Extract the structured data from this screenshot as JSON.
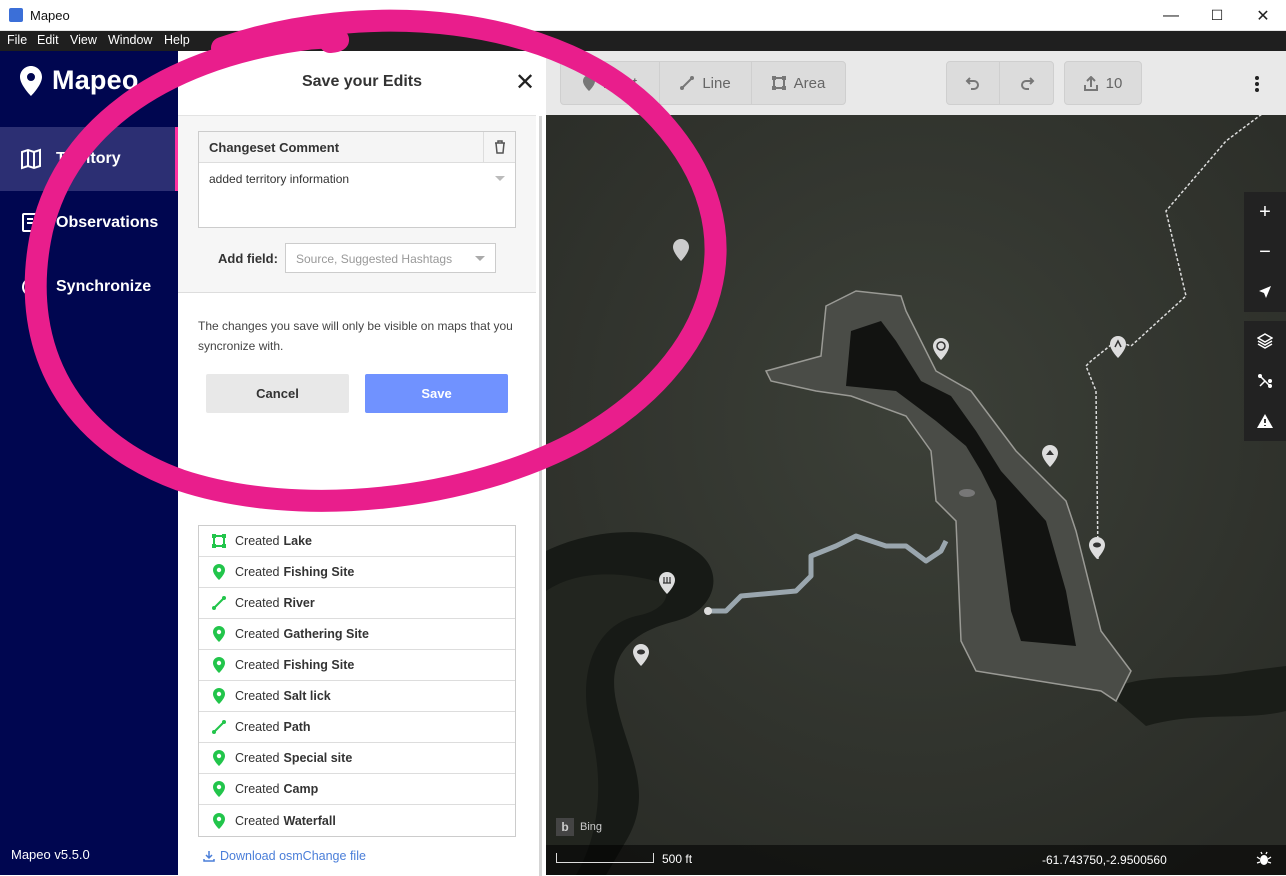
{
  "window": {
    "title": "Mapeo",
    "minimize": "—",
    "maximize": "☐",
    "close": "✕"
  },
  "menu": [
    "File",
    "Edit",
    "View",
    "Window",
    "Help"
  ],
  "sidebar": {
    "logo": "Mapeo",
    "items": [
      {
        "label": "Territory",
        "icon": "map-icon",
        "active": true
      },
      {
        "label": "Observations",
        "icon": "observations-icon"
      },
      {
        "label": "Synchronize",
        "icon": "sync-icon"
      }
    ],
    "version": "Mapeo v5.5.0"
  },
  "panel": {
    "title": "Save your Edits",
    "close": "✕",
    "comment_label": "Changeset Comment",
    "comment_value": "added territory information",
    "add_field_label": "Add field:",
    "add_field_placeholder": "Source, Suggested Hashtags",
    "note": "The changes you save will only be visible on maps that you syncronize with.",
    "cancel": "Cancel",
    "save": "Save",
    "changes": [
      {
        "verb": "Created",
        "name": "Lake",
        "icon": "area-icon"
      },
      {
        "verb": "Created",
        "name": "Fishing Site",
        "icon": "point-icon"
      },
      {
        "verb": "Created",
        "name": "River",
        "icon": "line-icon"
      },
      {
        "verb": "Created",
        "name": "Gathering Site",
        "icon": "point-icon"
      },
      {
        "verb": "Created",
        "name": "Fishing Site",
        "icon": "point-icon"
      },
      {
        "verb": "Created",
        "name": "Salt lick",
        "icon": "point-icon"
      },
      {
        "verb": "Created",
        "name": "Path",
        "icon": "line-icon"
      },
      {
        "verb": "Created",
        "name": "Special site",
        "icon": "point-icon"
      },
      {
        "verb": "Created",
        "name": "Camp",
        "icon": "point-icon"
      },
      {
        "verb": "Created",
        "name": "Waterfall",
        "icon": "point-icon"
      }
    ],
    "download": "Download osmChange file"
  },
  "toolbar": {
    "point": "Point",
    "line": "Line",
    "area": "Area",
    "upload_count": "10"
  },
  "map": {
    "attribution": "Bing",
    "scale": "500 ft",
    "coords": "-61.743750,-2.9500560"
  },
  "colors": {
    "sidebar": "#000650",
    "accent": "#ff2fa0",
    "save": "#7092ff",
    "created": "#22c54b"
  }
}
